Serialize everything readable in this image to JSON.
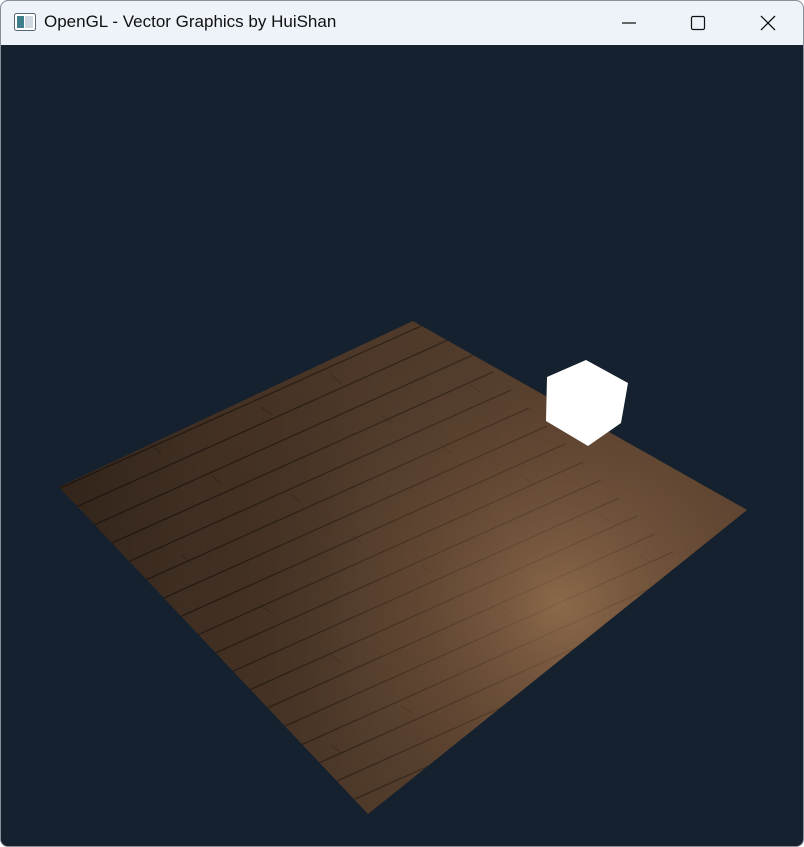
{
  "window": {
    "title": "OpenGL - Vector Graphics by HuiShan",
    "icon": "opengl-app-icon",
    "controls": [
      "minimize-icon",
      "maximize-icon",
      "close-icon"
    ]
  },
  "scene": {
    "background_color": "#15212e",
    "floor": {
      "texture": "wood-planks",
      "color": "#6a4c33"
    },
    "light_cube": {
      "color": "#ffffff"
    }
  }
}
